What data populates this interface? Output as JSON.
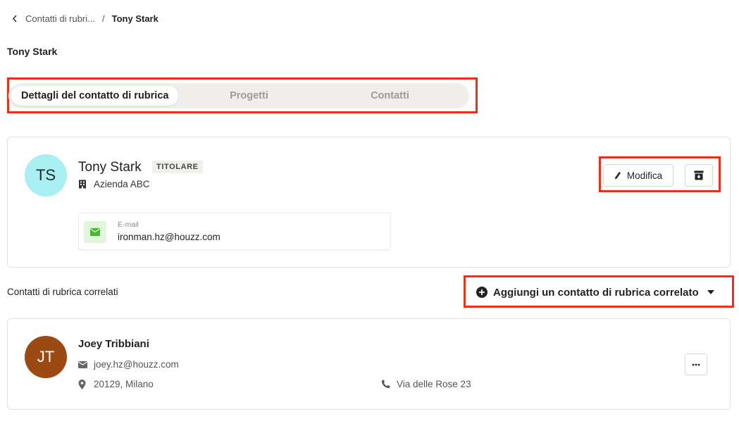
{
  "breadcrumb": {
    "parent_label": "Contatti di rubri...",
    "separator": "/",
    "current_label": "Tony Stark"
  },
  "page": {
    "title": "Tony Stark"
  },
  "tabs": [
    {
      "label": "Dettagli del contatto di rubrica",
      "active": true
    },
    {
      "label": "Progetti",
      "active": false
    },
    {
      "label": "Contatti",
      "active": false
    }
  ],
  "contact": {
    "initials": "TS",
    "name": "Tony Stark",
    "role": "TITOLARE",
    "company": "Azienda ABC",
    "email_label": "E-mail",
    "email": "ironman.hz@houzz.com",
    "edit_label": "Modifica"
  },
  "related": {
    "section_title": "Contatti di rubrica correlati",
    "add_label": "Aggiungi un contatto di rubrica correlato",
    "items": [
      {
        "initials": "JT",
        "name": "Joey Tribbiani",
        "email": "joey.hz@houzz.com",
        "city": "20129, Milano",
        "street": "Via delle Rose 23"
      }
    ]
  },
  "icons": {
    "back": "chevron-left-icon",
    "company": "building-icon",
    "email": "envelope-icon",
    "edit": "pencil-icon",
    "archive": "archive-box-icon",
    "add": "plus-circle-icon",
    "caret": "caret-down-icon",
    "location": "map-pin-icon",
    "phone": "phone-icon",
    "more": "ellipsis-icon"
  },
  "colors": {
    "highlight": "#e8311a",
    "avatar_ts": "#a8eef2",
    "avatar_jt": "#9c4a12",
    "email_icon_bg": "#e3f5dc",
    "email_icon": "#4cb632"
  }
}
